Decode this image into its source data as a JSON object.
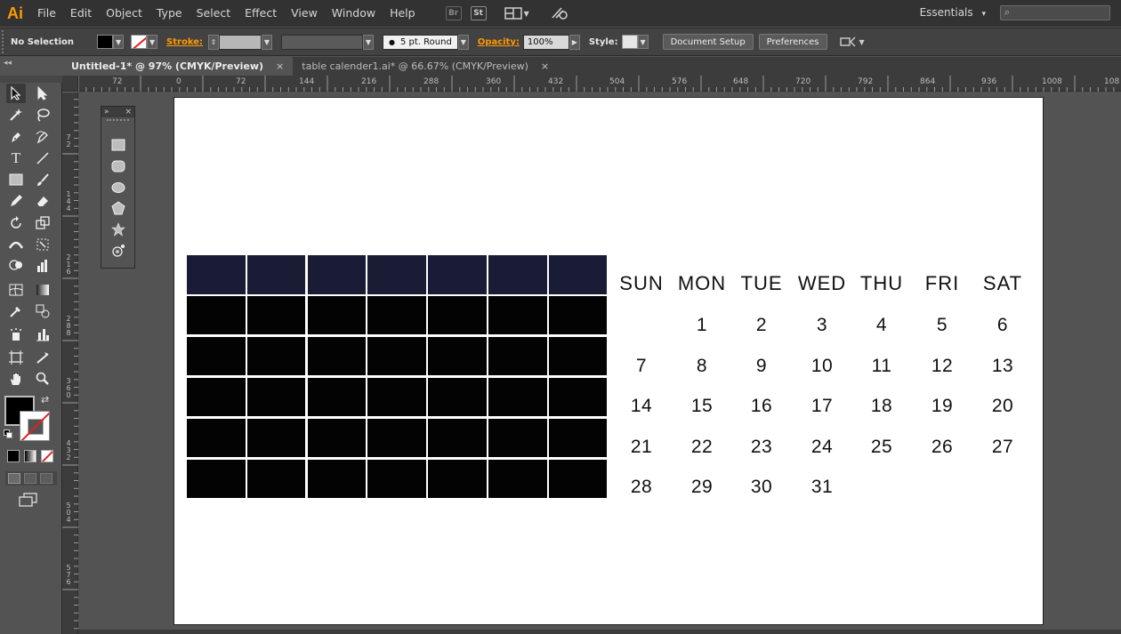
{
  "app": {
    "logo": "Ai"
  },
  "menu": [
    "File",
    "Edit",
    "Object",
    "Type",
    "Select",
    "Effect",
    "View",
    "Window",
    "Help"
  ],
  "menubar_icons": {
    "bridge": "Br",
    "stock": "St"
  },
  "workspace": {
    "label": "Essentials",
    "arrow": "▾"
  },
  "search": {
    "icon": "⌕"
  },
  "control": {
    "selection": "No Selection",
    "stroke_label": "Stroke:",
    "brush": "5 pt. Round",
    "opacity_label": "Opacity:",
    "opacity_value": "100%",
    "style_label": "Style:",
    "document_setup": "Document Setup",
    "preferences": "Preferences"
  },
  "tabs": [
    {
      "label": "Untitled-1* @ 97% (CMYK/Preview)",
      "close": "×"
    },
    {
      "label": "table calender1.ai* @ 66.67% (CMYK/Preview)",
      "close": "×"
    }
  ],
  "ruler_h": [
    "72",
    "0",
    "72",
    "144",
    "216",
    "288",
    "360",
    "432",
    "504",
    "576",
    "648",
    "720",
    "792",
    "864",
    "936",
    "1008",
    "108"
  ],
  "ruler_v": [
    "72",
    "144",
    "216",
    "288",
    "360",
    "432",
    "504",
    "576"
  ],
  "shape_panel": {
    "collapse": "»",
    "close": "×"
  },
  "colors": {
    "header_cell": "#1a1c36",
    "body_cell": "#030303",
    "accent": "#ff9a00"
  },
  "calendar": {
    "days": [
      "SUN",
      "MON",
      "TUE",
      "WED",
      "THU",
      "FRI",
      "SAT"
    ],
    "weeks": [
      [
        "",
        "1",
        "2",
        "3",
        "4",
        "5",
        "6"
      ],
      [
        "7",
        "8",
        "9",
        "10",
        "11",
        "12",
        "13"
      ],
      [
        "14",
        "15",
        "16",
        "17",
        "18",
        "19",
        "20"
      ],
      [
        "21",
        "22",
        "23",
        "24",
        "25",
        "26",
        "27"
      ],
      [
        "28",
        "29",
        "30",
        "31",
        "",
        "",
        ""
      ]
    ]
  }
}
